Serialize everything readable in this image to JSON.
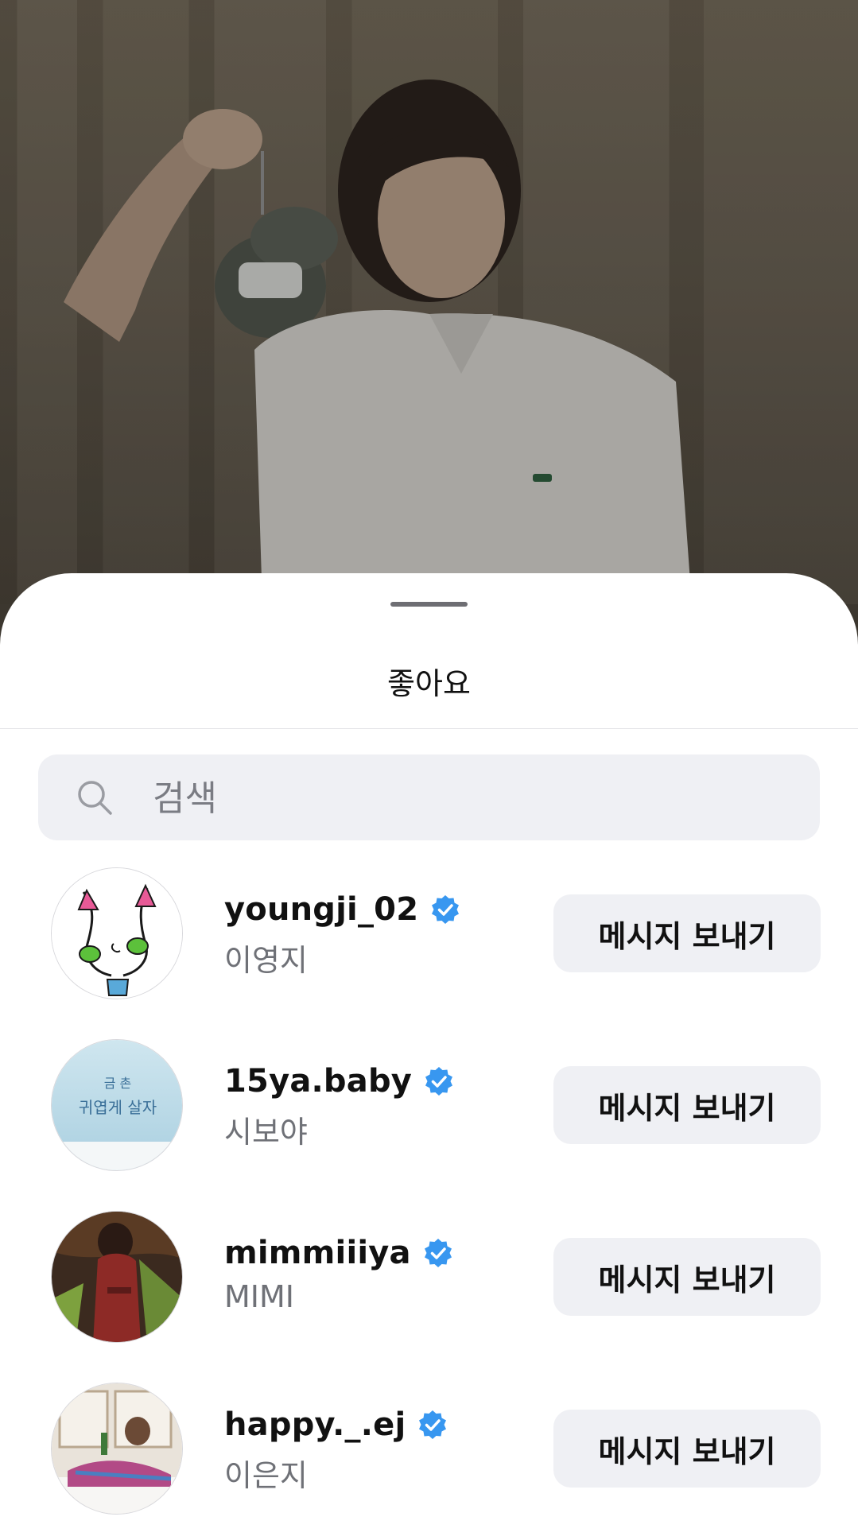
{
  "sheet": {
    "title": "좋아요",
    "search": {
      "placeholder": "검색"
    }
  },
  "users": [
    {
      "username": "youngji_02",
      "full_name": "이영지",
      "verified": true,
      "action": "메시지 보내기"
    },
    {
      "username": "15ya.baby",
      "full_name": "시보야",
      "verified": true,
      "action": "메시지 보내기",
      "avatar_text": [
        "금 촌",
        "귀엽게 살자"
      ]
    },
    {
      "username": "mimmiiiya",
      "full_name": "MIMI",
      "verified": true,
      "action": "메시지 보내기"
    },
    {
      "username": "happy._.ej",
      "full_name": "이은지",
      "verified": true,
      "action": "메시지 보내기"
    }
  ],
  "colors": {
    "verified": "#3897f0",
    "button_bg": "#eff0f4",
    "secondary_text": "#6f7177"
  }
}
